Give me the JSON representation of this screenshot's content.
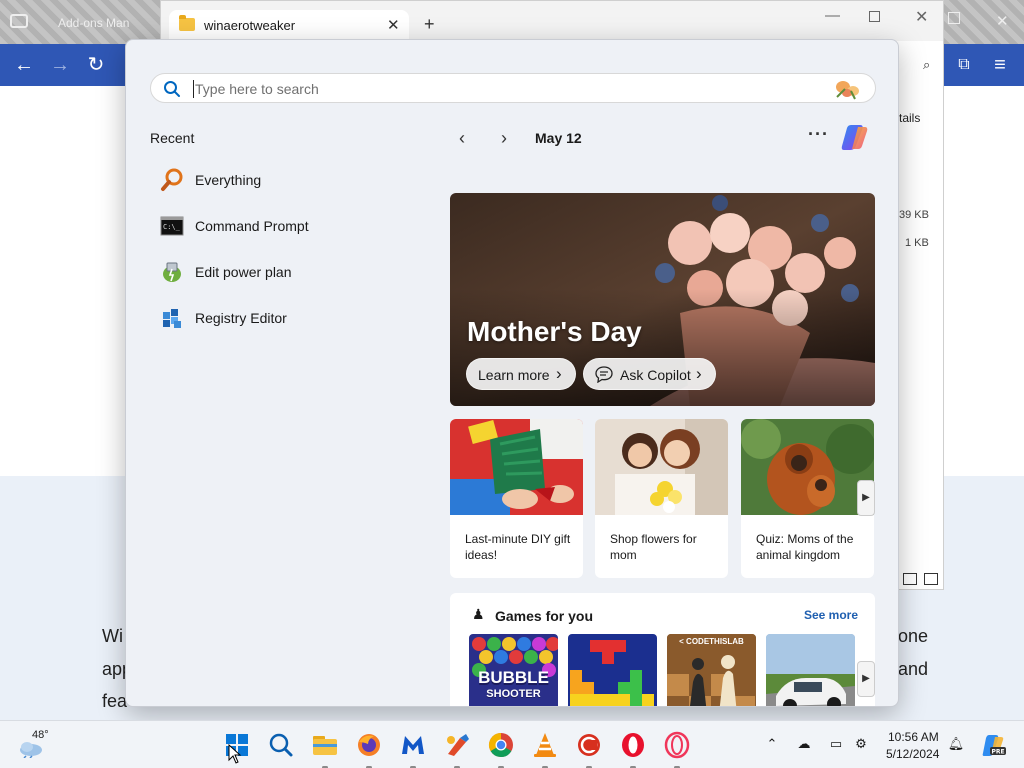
{
  "browser": {
    "background_tab_label": "Add-ons Man",
    "article_lines": [
      "Wi",
      "app",
      "fea"
    ],
    "article_lines_right": [
      "one",
      "and"
    ]
  },
  "explorer": {
    "tab_title": "winaerotweaker",
    "details_label": "tails",
    "file_sizes": [
      "39 KB",
      "1 KB"
    ]
  },
  "start_menu": {
    "search": {
      "placeholder": "Type here to search",
      "value": ""
    },
    "recent_title": "Recent",
    "recent_items": [
      {
        "label": "Everything",
        "icon": "everything-icon"
      },
      {
        "label": "Command Prompt",
        "icon": "command-prompt-icon"
      },
      {
        "label": "Edit power plan",
        "icon": "power-plan-icon"
      },
      {
        "label": "Registry Editor",
        "icon": "registry-editor-icon"
      }
    ],
    "date_label": "May 12",
    "more_label": "···",
    "hero": {
      "title": "Mother's Day",
      "learn_more": "Learn more",
      "ask_copilot": "Ask Copilot"
    },
    "cards": [
      {
        "text": "Last-minute DIY gift ideas!"
      },
      {
        "text": "Shop flowers for mom"
      },
      {
        "text": "Quiz: Moms of the animal kingdom"
      }
    ],
    "games": {
      "title": "Games for you",
      "see_more": "See more",
      "tiles": [
        {
          "line1": "BUBBLE",
          "line2": "SHOOTER"
        },
        {
          "line1": ""
        },
        {
          "line1": "< CODETHISLAB"
        },
        {
          "line1": ""
        }
      ]
    }
  },
  "taskbar": {
    "weather_temp": "48°",
    "clock_time": "10:56 AM",
    "clock_date": "5/12/2024",
    "apps": [
      "start",
      "search",
      "file-explorer",
      "firefox",
      "malwarebytes",
      "winaero-tweaker",
      "chrome",
      "vlc",
      "ccleaner",
      "opera",
      "opera-gx"
    ],
    "accent_color": "#0067c0"
  }
}
